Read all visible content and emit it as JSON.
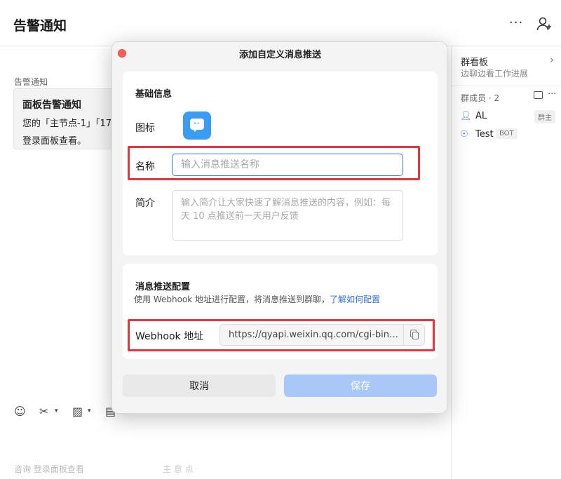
{
  "app": {
    "chat_title": "告警通知",
    "more_icon": "more-horizontal-icon",
    "add_member_icon": "add-user-icon"
  },
  "chat": {
    "sender": "告警通知",
    "card_title": "面板告警通知",
    "card_line1": "您的「主节点-1」「17",
    "card_line2": "登录面板查看。"
  },
  "composer": {
    "tools": [
      "emoji-icon",
      "scissors-icon",
      "image-icon",
      "document-icon"
    ],
    "bottom_left": "咨询 登录面板查看",
    "bottom_mid": "主 意 点"
  },
  "right_panel": {
    "board_title": "群看板",
    "board_subtitle": "边聊边看工作进展",
    "members_label": "群成员 · 2",
    "members": [
      {
        "name": "AL",
        "tag": "群主",
        "icon": "user-icon"
      },
      {
        "name": "Test",
        "tag": "BOT",
        "icon": "bot-icon"
      }
    ]
  },
  "modal": {
    "title": "添加自定义消息推送",
    "basic_section_title": "基础信息",
    "icon_label": "图标",
    "name_label": "名称",
    "name_placeholder": "输入消息推送名称",
    "name_value": "",
    "desc_label": "简介",
    "desc_placeholder": "输入简介让大家快速了解消息推送的内容，例如：每天 10 点推送前一天用户反馈",
    "config_section_title": "消息推送配置",
    "config_desc": "使用 Webhook 地址进行配置，将消息推送到群聊，",
    "config_link": "了解如何配置",
    "webhook_label": "Webhook 地址",
    "webhook_value": "https://qyapi.weixin.qq.com/cgi-bin/...",
    "cancel_label": "取消",
    "save_label": "保存"
  },
  "colors": {
    "accent": "#2f7cf6",
    "save_disabled": "#a9c8f7",
    "highlight_red": "#e8343a",
    "icon_tile": "#3a9cf5",
    "mac_close": "#ff5f57"
  }
}
